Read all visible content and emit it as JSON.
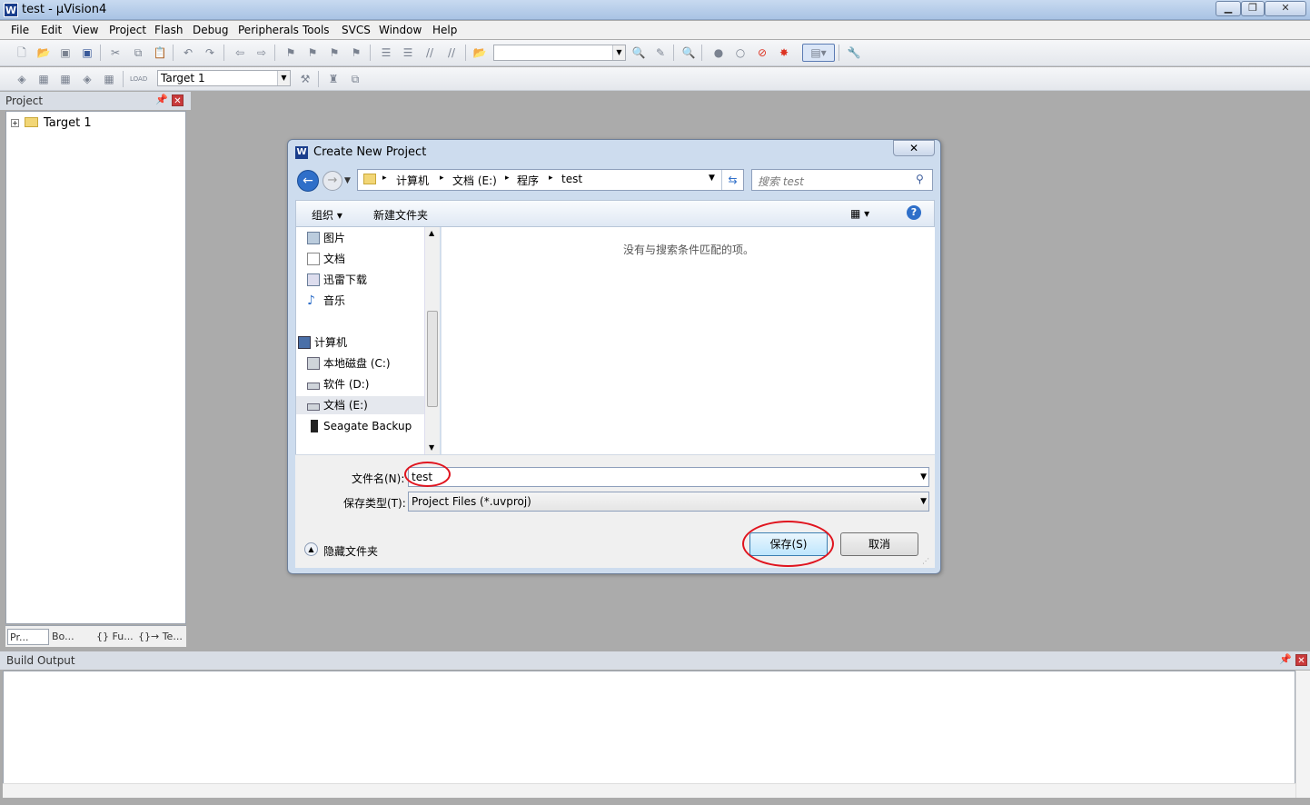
{
  "window": {
    "title": "test  - µVision4",
    "icon": "uvision-logo-icon"
  },
  "menubar": [
    "File",
    "Edit",
    "View",
    "Project",
    "Flash",
    "Debug",
    "Peripherals",
    "Tools",
    "SVCS",
    "Window",
    "Help"
  ],
  "toolbar2": {
    "target_select": "Target 1"
  },
  "project_pane": {
    "title": "Project",
    "tree_root": "Target 1",
    "tabs": [
      "Pr...",
      "Bo...",
      "{} Fu...",
      "{}→ Te..."
    ]
  },
  "build_output": {
    "title": "Build Output"
  },
  "dialog": {
    "title": "Create New Project",
    "breadcrumb": [
      "计算机",
      "文档 (E:)",
      "程序",
      "test"
    ],
    "search_placeholder": "搜索 test",
    "organize": "组织 ▾",
    "new_folder": "新建文件夹",
    "nav_items_top": [
      "图片",
      "文档",
      "迅雷下载",
      "音乐"
    ],
    "nav_computer": "计算机",
    "nav_drives": [
      "本地磁盘 (C:)",
      "软件 (D:)",
      "文档 (E:)",
      "Seagate Backup"
    ],
    "empty_message": "没有与搜索条件匹配的项。",
    "filename_label": "文件名(N):",
    "filename_value": "test",
    "filetype_label": "保存类型(T):",
    "filetype_value": "Project Files (*.uvproj)",
    "hide_folders": "隐藏文件夹",
    "save_button": "保存(S)",
    "cancel_button": "取消"
  },
  "colors": {
    "highlight_circle": "#e0141e",
    "accent": "#1a3e8c"
  }
}
